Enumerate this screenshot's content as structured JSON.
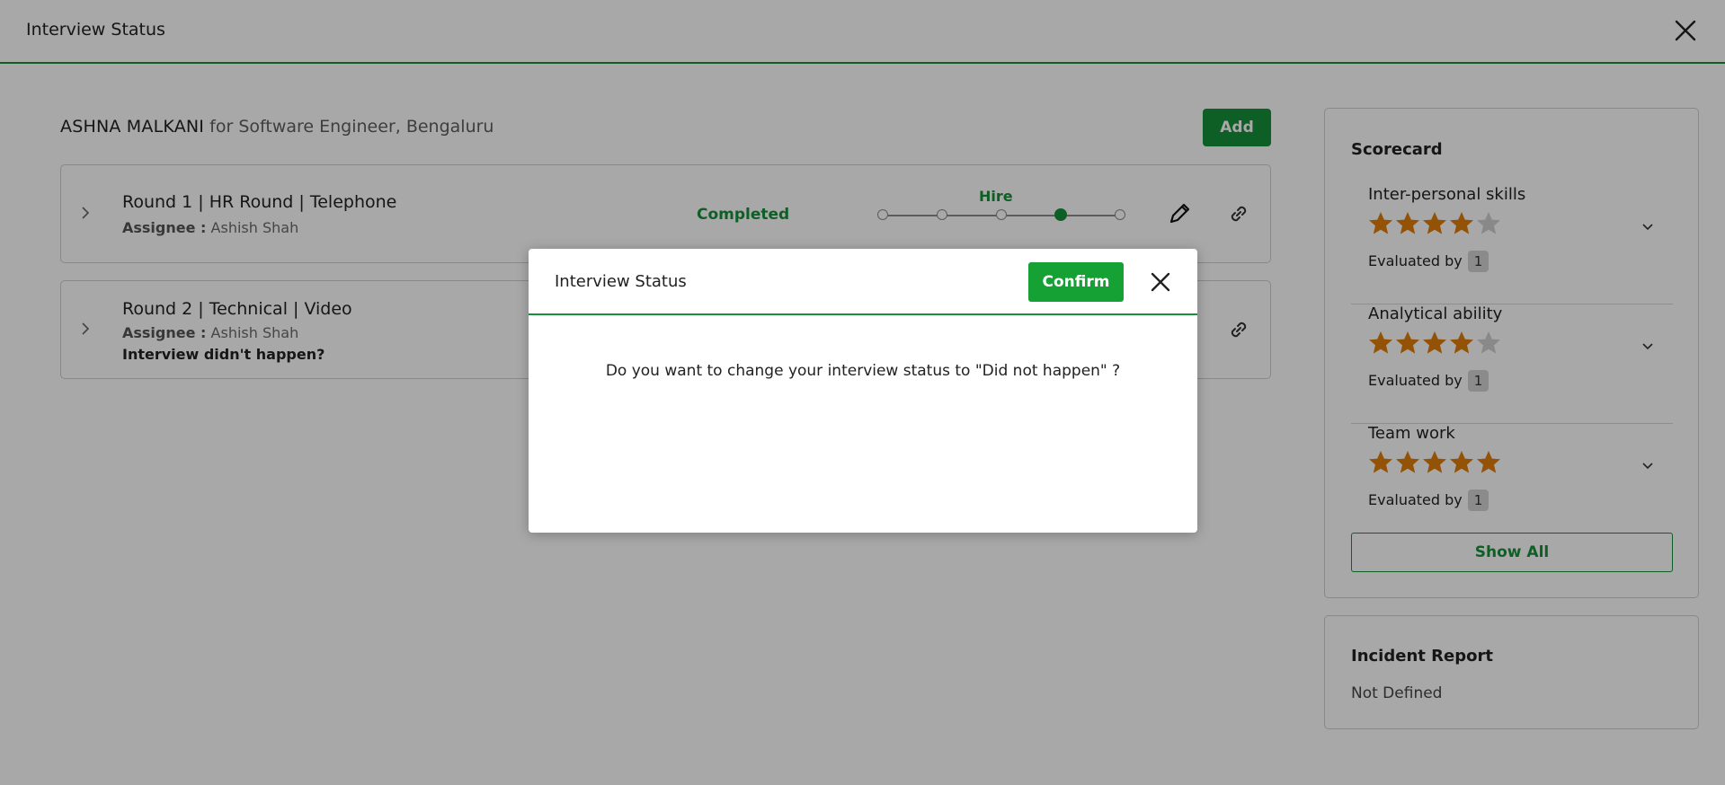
{
  "topbar": {
    "title": "Interview Status"
  },
  "candidate": {
    "name": "ASHNA MALKANI",
    "role_text": "for Software Engineer, Bengaluru"
  },
  "actions": {
    "add_label": "Add"
  },
  "rounds": [
    {
      "title": "Round 1 | HR Round | Telephone",
      "assignee_label": "Assignee :",
      "assignee": "Ashish Shah",
      "status": "Completed",
      "decision": "Hire",
      "decision_level": 4,
      "decision_steps": 5
    },
    {
      "title": "Round 2 | Technical | Video",
      "assignee_label": "Assignee :",
      "assignee": "Ashish Shah",
      "note": "Interview didn't happen?"
    }
  ],
  "scorecard": {
    "title": "Scorecard",
    "evaluated_label": "Evaluated by",
    "skills": [
      {
        "name": "Inter-personal skills",
        "rating": 4,
        "max": 5,
        "evaluated_count": "1"
      },
      {
        "name": "Analytical ability",
        "rating": 4,
        "max": 5,
        "evaluated_count": "1"
      },
      {
        "name": "Team work",
        "rating": 5,
        "max": 5,
        "evaluated_count": "1"
      }
    ],
    "show_all_label": "Show All"
  },
  "incident": {
    "title": "Incident Report",
    "value": "Not Defined"
  },
  "modal": {
    "title": "Interview Status",
    "confirm_label": "Confirm",
    "message": "Do you want to change your interview status to \"Did not happen\" ?"
  },
  "colors": {
    "accent": "#16913a",
    "star_filled": "#e07d0a",
    "star_empty": "#d0d0d0"
  },
  "icons": [
    "close-icon",
    "chevron-right-icon",
    "pencil-icon",
    "link-icon",
    "chevron-down-icon",
    "star-icon"
  ]
}
